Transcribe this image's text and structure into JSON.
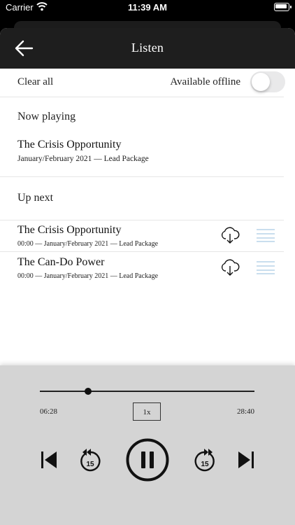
{
  "status_bar": {
    "carrier": "Carrier",
    "time": "11:39 AM"
  },
  "nav": {
    "title": "Listen"
  },
  "options": {
    "clear_all": "Clear all",
    "available_offline": "Available offline",
    "offline_enabled": false
  },
  "now_playing": {
    "heading": "Now playing",
    "title": "The Crisis Opportunity",
    "meta": "January/February 2021 — Lead Package"
  },
  "up_next": {
    "heading": "Up next",
    "items": [
      {
        "title": "The Crisis Opportunity",
        "meta": "00:00 — January/February 2021 — Lead Package"
      },
      {
        "title": "The Can-Do Power",
        "meta": "00:00 — January/February 2021 — Lead Package"
      }
    ]
  },
  "player": {
    "elapsed": "06:28",
    "duration": "28:40",
    "speed": "1x",
    "progress": 0.2256,
    "rewind_seconds": "15",
    "forward_seconds": "15"
  },
  "colors": {
    "nav_bg": "#1e1e1e",
    "player_bg": "#d4d4d4",
    "handle": "#a9c9e3"
  }
}
